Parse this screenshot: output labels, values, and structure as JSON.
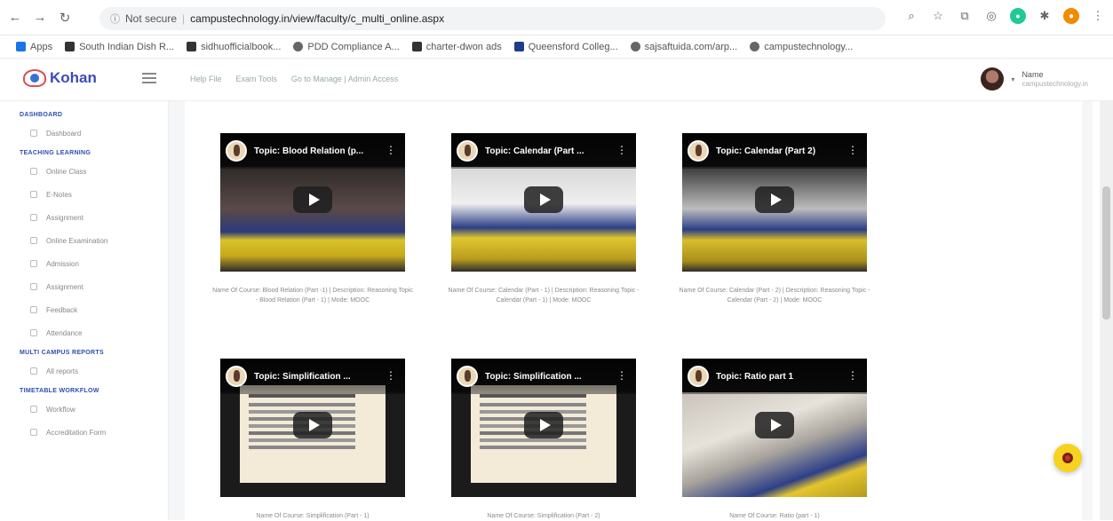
{
  "browser": {
    "security": "Not secure",
    "url": "campustechnology.in/view/faculty/c_multi_online.aspx",
    "bookmarks": [
      {
        "label": "Apps",
        "icon": "apps-grid-icon"
      },
      {
        "label": "South Indian Dish R...",
        "icon": "bookmark-icon"
      },
      {
        "label": "sidhuofficialbook...",
        "icon": "bookmark-icon"
      },
      {
        "label": "PDD Compliance A...",
        "icon": "globe-icon"
      },
      {
        "label": "charter-dwon ads",
        "icon": "bookmark-icon"
      },
      {
        "label": "Queensford Colleg...",
        "icon": "bookmark-icon"
      },
      {
        "label": "sajsaftuida.com/arp...",
        "icon": "globe-icon"
      },
      {
        "label": "campustechnology...",
        "icon": "globe-icon"
      }
    ]
  },
  "app": {
    "logo_text": "Kohan",
    "header_links": [
      "Help File",
      "Exam Tools",
      "Go to Manage | Admin Access"
    ],
    "user_name": "Name",
    "user_role": "campustechnology.in"
  },
  "sidebar": {
    "sections": [
      {
        "title": "DASHBOARD",
        "items": [
          "Dashboard"
        ]
      },
      {
        "title": "TEACHING LEARNING",
        "items": [
          "Online Class",
          "E-Notes",
          "Assignment",
          "Online Examination",
          "Admission",
          "Assignment",
          "Feedback",
          "Attendance"
        ]
      },
      {
        "title": "MULTI CAMPUS REPORTS",
        "items": [
          "All reports"
        ]
      },
      {
        "title": "TIMETABLE WORKFLOW",
        "items": [
          "Workflow",
          "Accreditation Form"
        ]
      }
    ]
  },
  "videos": [
    {
      "title": "Topic: Blood Relation (p...",
      "caption": "Name Of Course: Blood Relation (Part -1) | Description: Reasoning Topic - Blood Relation (Part - 1) | Mode: MOOC",
      "scene": "lab"
    },
    {
      "title": "Topic: Calendar (Part ...",
      "caption": "Name Of Course: Calendar (Part - 1) | Description: Reasoning Topic - Calendar (Part - 1) | Mode: MOOC",
      "scene": "lab2"
    },
    {
      "title": "Topic: Calendar (Part 2)",
      "caption": "Name Of Course: Calendar (Part - 2) | Description: Reasoning Topic - Calendar (Part - 2) | Mode: MOOC",
      "scene": "lab3"
    },
    {
      "title": "Topic: Simplification ...",
      "caption": "Name Of Course: Simplification (Part - 1)",
      "scene": "slide"
    },
    {
      "title": "Topic: Simplification ...",
      "caption": "Name Of Course: Simplification (Part - 2)",
      "scene": "slide"
    },
    {
      "title": "Topic: Ratio part 1",
      "caption": "Name Of Course: Ratio (part - 1)",
      "scene": "photo"
    }
  ]
}
